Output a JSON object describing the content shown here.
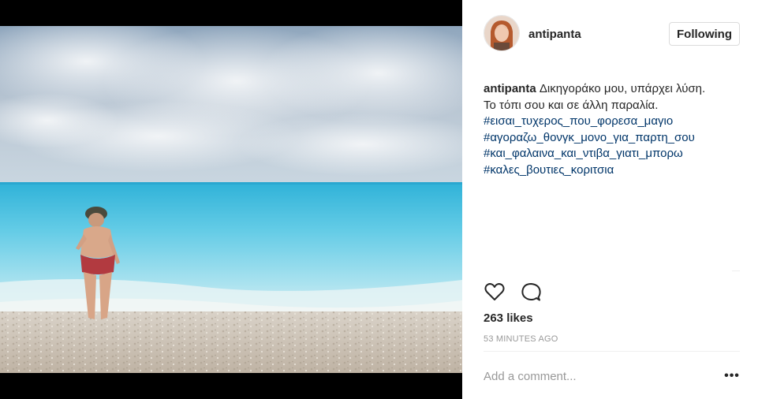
{
  "post": {
    "username": "antipanta",
    "follow_label": "Following",
    "caption": {
      "username": "antipanta",
      "text_line1": "Δικηγοράκο μου, υπάρχει λύση.",
      "text_line2": "Το τόπι σου και σε άλλη παραλία.",
      "hashtags": [
        "#εισαι_τυχερος_που_φορεσα_μαγιο",
        "#αγοραζω_θονγκ_μονο_για_παρτη_σου",
        "#και_φαλαινα_και_ντιβα_γιατι_μπορω",
        "#καλες_βουτιες_κοριτσια"
      ]
    },
    "likes": "263 likes",
    "timestamp": "53 MINUTES AGO",
    "comment_placeholder": "Add a comment...",
    "more_label": "•••"
  },
  "icons": {
    "like": "heart-icon",
    "comment": "comment-bubble-icon",
    "more": "more-options-icon"
  },
  "colors": {
    "hashtag": "#003569",
    "text": "#262626",
    "muted": "#999999",
    "border": "#dbdbdb"
  }
}
